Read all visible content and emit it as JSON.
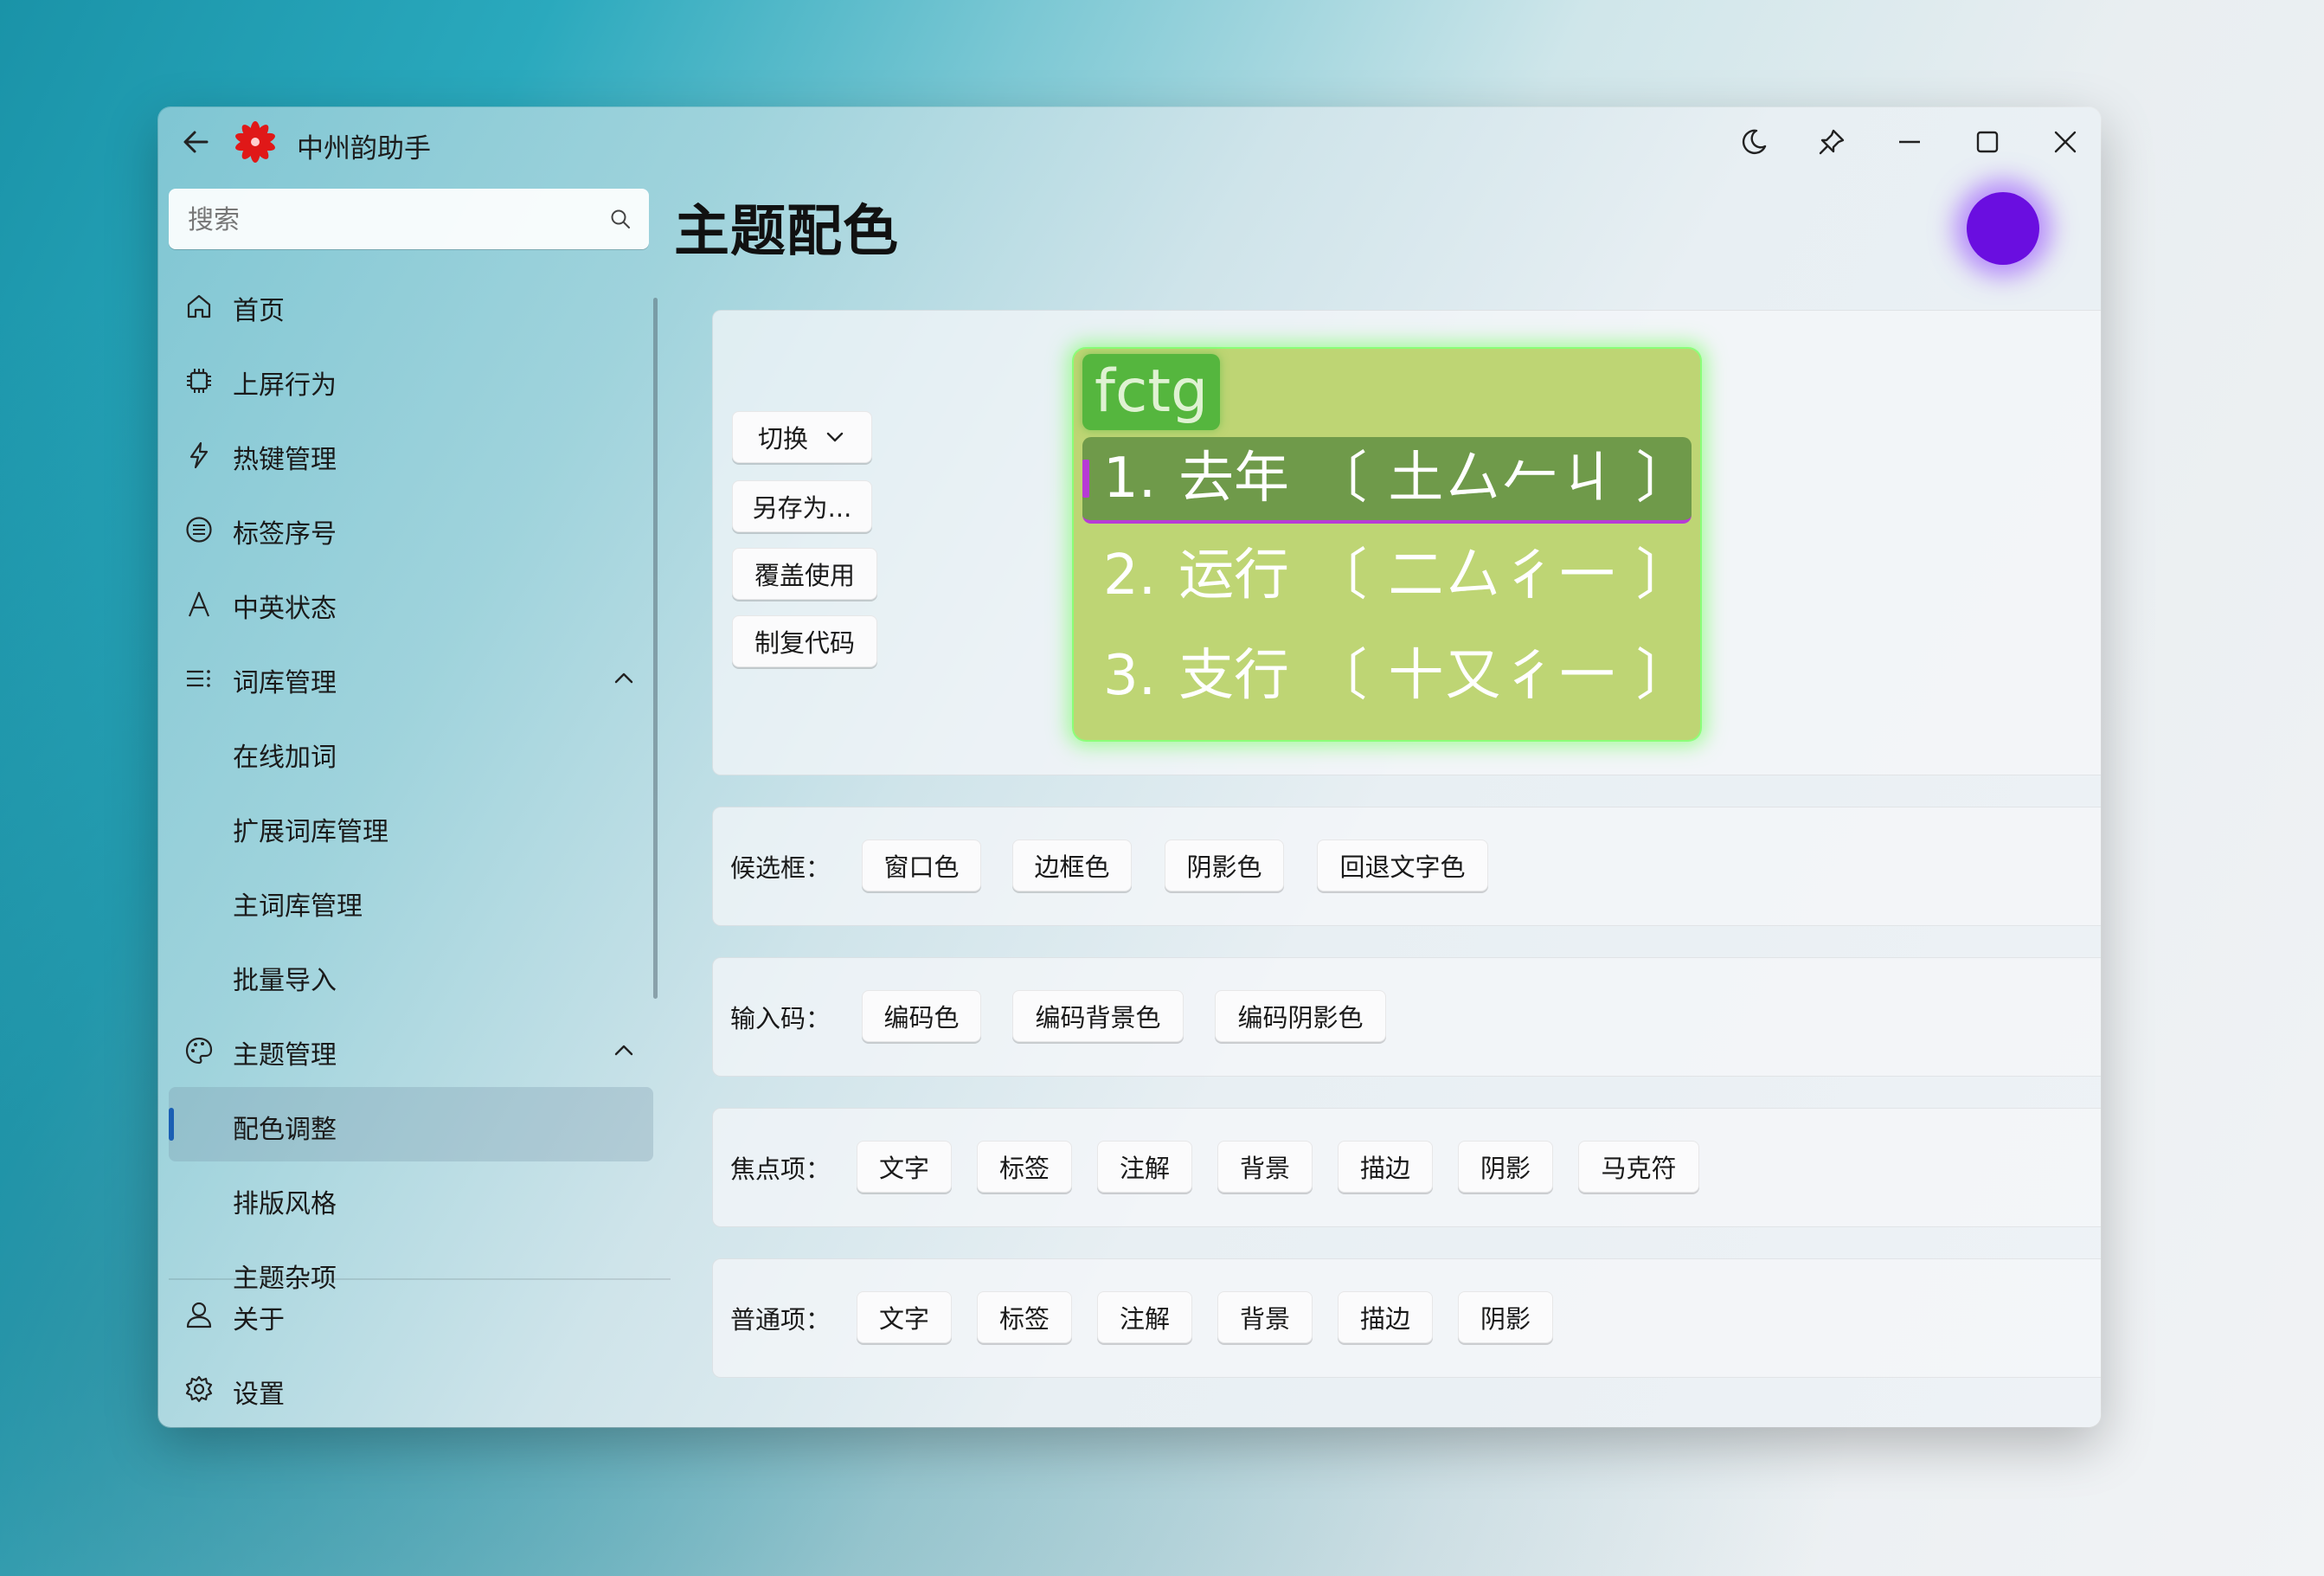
{
  "app": {
    "title": "中州韵助手"
  },
  "search": {
    "placeholder": "搜索"
  },
  "sidebar": {
    "items": [
      {
        "label": "首页"
      },
      {
        "label": "上屏行为"
      },
      {
        "label": "热键管理"
      },
      {
        "label": "标签序号"
      },
      {
        "label": "中英状态"
      },
      {
        "label": "词库管理",
        "expanded": true
      },
      {
        "label": "在线加词"
      },
      {
        "label": "扩展词库管理"
      },
      {
        "label": "主词库管理"
      },
      {
        "label": "批量导入"
      },
      {
        "label": "主题管理",
        "expanded": true
      },
      {
        "label": "配色调整",
        "selected": true
      },
      {
        "label": "排版风格"
      },
      {
        "label": "主题杂项"
      }
    ],
    "footer": [
      {
        "label": "关于"
      },
      {
        "label": "设置"
      }
    ]
  },
  "page": {
    "title": "主题配色"
  },
  "avatar": {
    "color": "#6a0ee0"
  },
  "preview_actions": {
    "switch_label": "切换",
    "save_as_label": "另存为...",
    "overwrite_label": "覆盖使用",
    "copy_code_label": "制复代码"
  },
  "preview": {
    "code": "fctg",
    "candidates": [
      {
        "index": "1.",
        "word": "去年",
        "note": "〔 土厶𠂉ㄐ 〕",
        "focused": true
      },
      {
        "index": "2.",
        "word": "运行",
        "note": "〔 二厶彳一 〕"
      },
      {
        "index": "3.",
        "word": "支行",
        "note": "〔 十又彳一 〕"
      }
    ],
    "colors": {
      "window": "#bed574",
      "border_glow": "#6eff5a",
      "code_background": "#55b63e",
      "focus_background": "#6f9a4a",
      "focus_marker": "#b73bd6",
      "text": "#ffffff"
    }
  },
  "rows": {
    "candidate_box": {
      "label": "候选框：",
      "buttons": [
        "窗口色",
        "边框色",
        "阴影色",
        "回退文字色"
      ]
    },
    "input_code": {
      "label": "输入码：",
      "buttons": [
        "编码色",
        "编码背景色",
        "编码阴影色"
      ]
    },
    "focus_item": {
      "label": "焦点项：",
      "buttons": [
        "文字",
        "标签",
        "注解",
        "背景",
        "描边",
        "阴影",
        "马克符"
      ]
    },
    "normal_item": {
      "label": "普通项：",
      "buttons": [
        "文字",
        "标签",
        "注解",
        "背景",
        "描边",
        "阴影"
      ]
    }
  }
}
